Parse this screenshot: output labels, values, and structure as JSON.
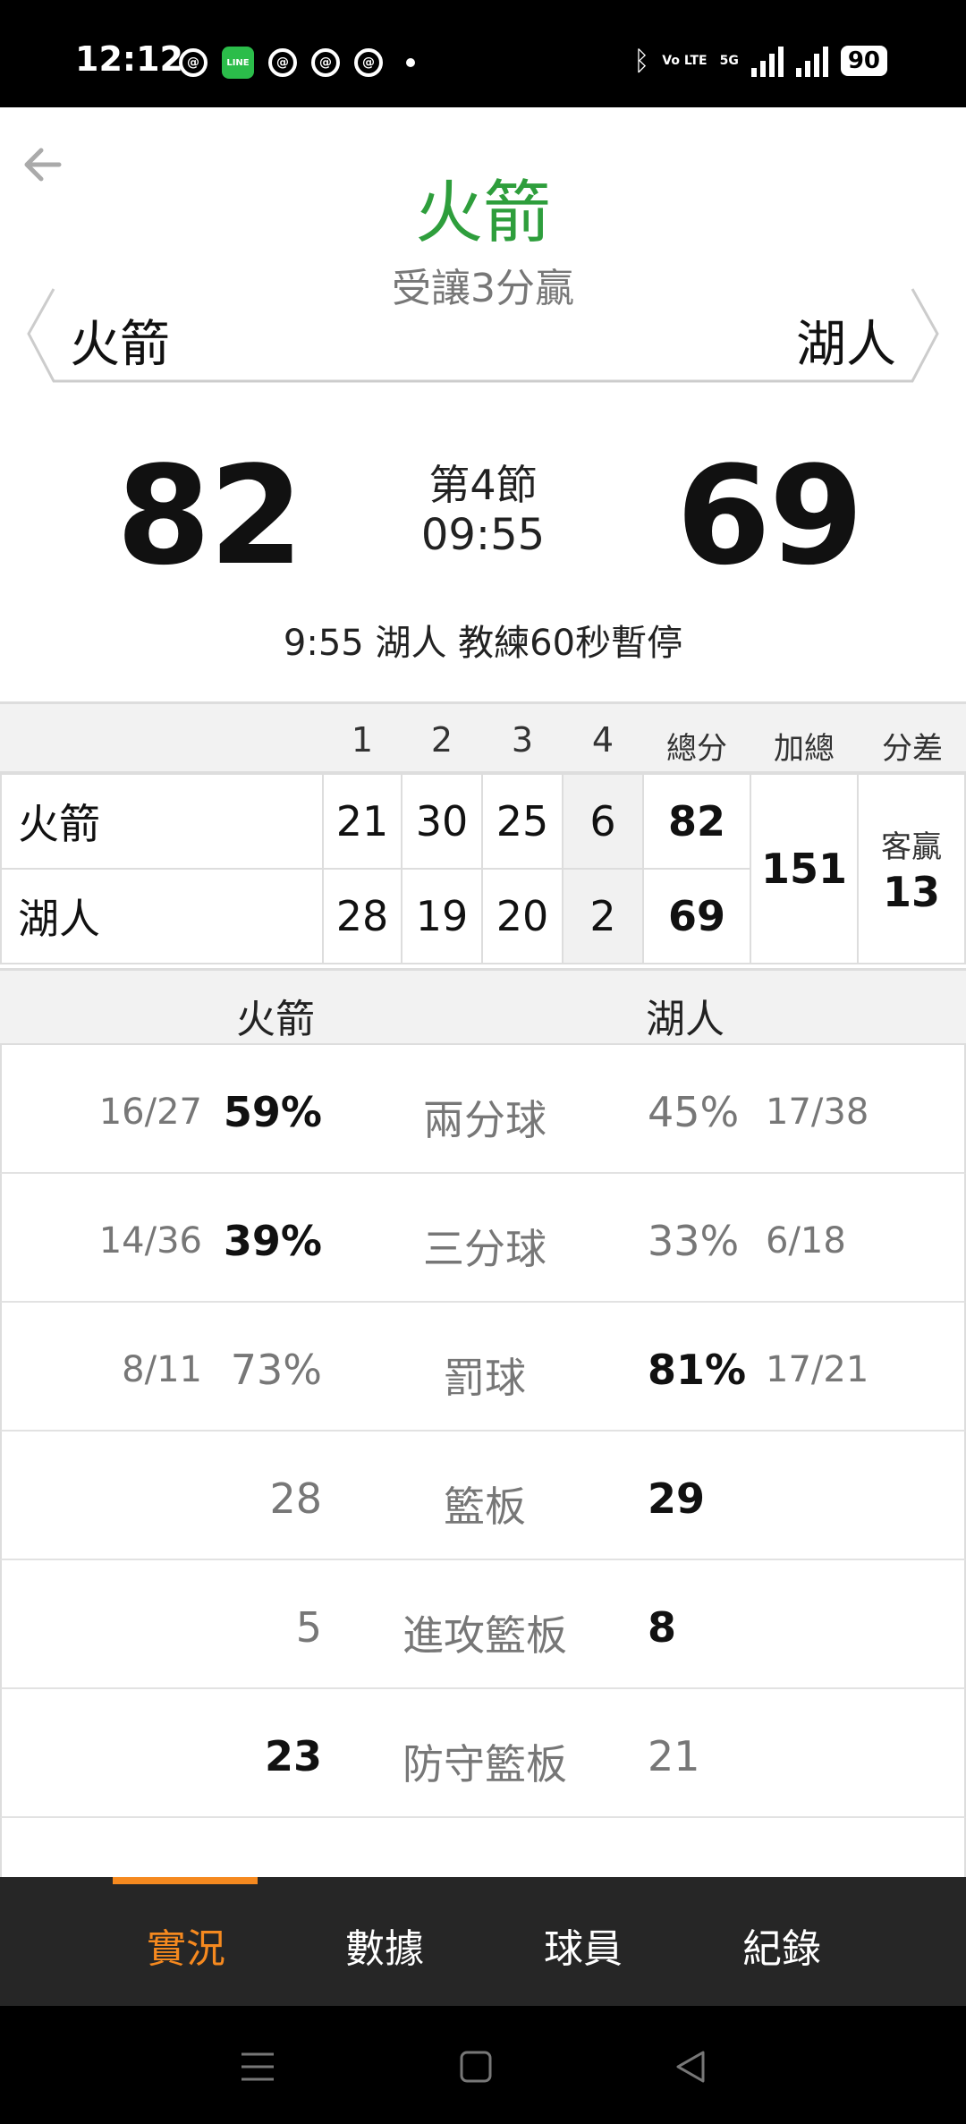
{
  "status_bar": {
    "time": "12:12",
    "battery": "90",
    "network": "5G",
    "volte": "Vo LTE",
    "icons": [
      "threads-icon",
      "line-icon",
      "threads-icon",
      "threads-icon",
      "threads-icon",
      "bluetooth-icon",
      "signal-icon"
    ]
  },
  "header": {
    "pick_team": "火箭",
    "pick_desc": "受讓3分贏",
    "team_left": "火箭",
    "team_right": "湖人",
    "accent_color": "#2e9e3c"
  },
  "score": {
    "left": "82",
    "right": "69",
    "period": "第4節",
    "clock": "09:55",
    "event": "9:55 湖人  教練60秒暫停"
  },
  "quarter_table": {
    "headers": [
      "1",
      "2",
      "3",
      "4",
      "總分",
      "加總",
      "分差"
    ],
    "rows": [
      {
        "team": "火箭",
        "q": [
          "21",
          "30",
          "25",
          "6"
        ],
        "total": "82"
      },
      {
        "team": "湖人",
        "q": [
          "28",
          "19",
          "20",
          "2"
        ],
        "total": "69"
      }
    ],
    "combined": "151",
    "diff_label": "客贏",
    "diff_value": "13"
  },
  "stats": {
    "team_left": "火箭",
    "team_right": "湖人",
    "rows": [
      {
        "label": "兩分球",
        "l_frac": "16/27",
        "l_val": "59%",
        "r_val": "45%",
        "r_frac": "17/38"
      },
      {
        "label": "三分球",
        "l_frac": "14/36",
        "l_val": "39%",
        "r_val": "33%",
        "r_frac": "6/18"
      },
      {
        "label": "罰球",
        "l_frac": "8/11",
        "l_val": "73%",
        "r_val": "81%",
        "r_frac": "17/21"
      },
      {
        "label": "籃板",
        "l_frac": "",
        "l_val": "28",
        "r_val": "29",
        "r_frac": ""
      },
      {
        "label": "進攻籃板",
        "l_frac": "",
        "l_val": "5",
        "r_val": "8",
        "r_frac": ""
      },
      {
        "label": "防守籃板",
        "l_frac": "",
        "l_val": "23",
        "r_val": "21",
        "r_frac": ""
      }
    ]
  },
  "tabs": [
    "實況",
    "數據",
    "球員",
    "紀錄"
  ],
  "active_tab_color": "#f5891f"
}
